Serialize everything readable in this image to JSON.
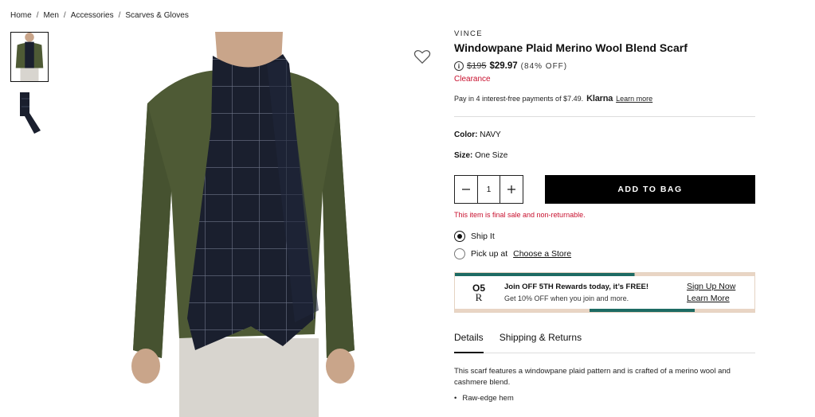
{
  "breadcrumb": {
    "items": [
      "Home",
      "Men",
      "Accessories",
      "Scarves & Gloves"
    ],
    "separator": "/"
  },
  "product": {
    "brand": "VINCE",
    "title": "Windowpane Plaid Merino Wool Blend Scarf",
    "price_original": "$195",
    "price_sale": "$29.97",
    "discount": "(84% OFF)",
    "badge": "Clearance",
    "klarna": {
      "text": "Pay in 4 interest-free payments of $7.49.",
      "brand": "Klarna",
      "link": "Learn more"
    },
    "color_label": "Color:",
    "color_value": "NAVY",
    "size_label": "Size:",
    "size_value": "One Size",
    "quantity": "1",
    "add_to_bag": "ADD TO BAG",
    "final_sale_note": "This item is final sale and non-returnable."
  },
  "fulfillment": {
    "ship_label": "Ship It",
    "pickup_label": "Pick up at",
    "pickup_link": "Choose a Store",
    "selected": "ship"
  },
  "rewards": {
    "logo_top": "O5",
    "logo_bottom": "R",
    "headline": "Join OFF 5TH Rewards today, it’s FREE!",
    "subline": "Get 10% OFF when you join and more.",
    "sign_up": "Sign Up Now",
    "learn_more": "Learn More"
  },
  "tabs": [
    {
      "label": "Details",
      "active": true
    },
    {
      "label": "Shipping & Returns",
      "active": false
    }
  ],
  "details": {
    "description": "This scarf features a windowpane plaid pattern and is crafted of a merino wool and cashmere blend.",
    "bullets": [
      "Raw-edge hem"
    ]
  },
  "colors": {
    "sale_red": "#c8102e",
    "sweater_green": "#4e5a35",
    "scarf_navy": "#1a1f2e",
    "rewards_teal": "#1d6b63"
  },
  "icons": {
    "wishlist": "heart-outline-icon",
    "price_info": "info-icon",
    "qty_decrease": "minus-icon",
    "qty_increase": "plus-icon"
  }
}
